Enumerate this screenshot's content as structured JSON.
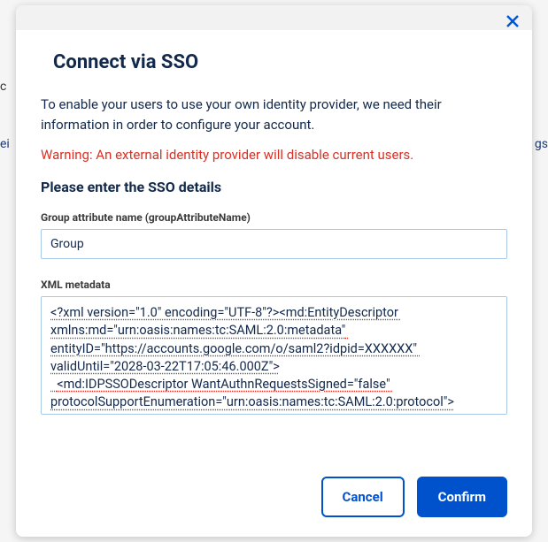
{
  "modal": {
    "title": "Connect via SSO",
    "description": "To enable your users to use your own identity provider, we need their information in order to configure your account.",
    "warning": "Warning: An external identity provider will disable current users.",
    "section_title": "Please enter the SSO details",
    "group_attribute": {
      "label": "Group attribute name (groupAttributeName)",
      "value": "Group"
    },
    "xml_metadata": {
      "label": "XML metadata",
      "value": "<?xml version=\"1.0\" encoding=\"UTF-8\"?><md:EntityDescriptor xmlns:md=\"urn:oasis:names:tc:SAML:2.0:metadata\" entityID=\"https://accounts.google.com/o/saml2?idpid=XXXXXX\" validUntil=\"2028-03-22T17:05:46.000Z\">\n  <md:IDPSSODescriptor WantAuthnRequestsSigned=\"false\" protocolSupportEnumeration=\"urn:oasis:names:tc:SAML:2.0:protocol\">"
    },
    "buttons": {
      "cancel": "Cancel",
      "confirm": "Confirm"
    }
  }
}
